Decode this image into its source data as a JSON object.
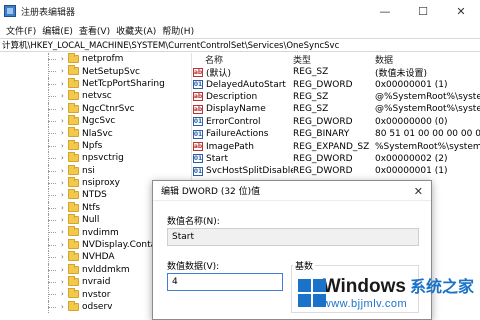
{
  "window": {
    "title": "注册表编辑器",
    "icon": "regedit-icon",
    "controls": {
      "minimize": "—",
      "maximize": "☐",
      "close": "✕"
    }
  },
  "menu": [
    "文件(F)",
    "编辑(E)",
    "查看(V)",
    "收藏夹(A)",
    "帮助(H)"
  ],
  "address": "计算机\\HKEY_LOCAL_MACHINE\\SYSTEM\\CurrentControlSet\\Services\\OneSyncSvc",
  "tree": [
    {
      "label": "netprofm",
      "expandable": true
    },
    {
      "label": "NetSetupSvc",
      "expandable": true
    },
    {
      "label": "NetTcpPortSharing",
      "expandable": true
    },
    {
      "label": "netvsc",
      "expandable": true
    },
    {
      "label": "NgcCtnrSvc",
      "expandable": true
    },
    {
      "label": "NgcSvc",
      "expandable": true
    },
    {
      "label": "NlaSvc",
      "expandable": true
    },
    {
      "label": "Npfs",
      "expandable": true
    },
    {
      "label": "npsvctrig",
      "expandable": true
    },
    {
      "label": "nsi",
      "expandable": true
    },
    {
      "label": "nsiproxy",
      "expandable": true
    },
    {
      "label": "NTDS",
      "expandable": true
    },
    {
      "label": "Ntfs",
      "expandable": true
    },
    {
      "label": "Null",
      "expandable": true
    },
    {
      "label": "nvdimm",
      "expandable": true
    },
    {
      "label": "NVDisplay.Container",
      "expandable": true
    },
    {
      "label": "NVHDA",
      "expandable": true
    },
    {
      "label": "nvlddmkm",
      "expandable": true
    },
    {
      "label": "nvraid",
      "expandable": true
    },
    {
      "label": "nvstor",
      "expandable": true
    },
    {
      "label": "odserv",
      "expandable": true
    }
  ],
  "values_header": {
    "name": "名称",
    "type": "类型",
    "data": "数据"
  },
  "values": [
    {
      "icon": "ab",
      "name": "(默认)",
      "type": "REG_SZ",
      "data": "(数值未设置)"
    },
    {
      "icon": "01",
      "name": "DelayedAutoStart",
      "type": "REG_DWORD",
      "data": "0x00000001 (1)"
    },
    {
      "icon": "ab",
      "name": "Description",
      "type": "REG_SZ",
      "data": "@%SystemRoot%\\system32"
    },
    {
      "icon": "ab",
      "name": "DisplayName",
      "type": "REG_SZ",
      "data": "@%SystemRoot%\\system32"
    },
    {
      "icon": "01",
      "name": "ErrorControl",
      "type": "REG_DWORD",
      "data": "0x00000000 (0)"
    },
    {
      "icon": "01",
      "name": "FailureActions",
      "type": "REG_BINARY",
      "data": "80 51 01 00 00 00 00 00 00"
    },
    {
      "icon": "ab",
      "name": "ImagePath",
      "type": "REG_EXPAND_SZ",
      "data": "%SystemRoot%\\system32\\"
    },
    {
      "icon": "01",
      "name": "Start",
      "type": "REG_DWORD",
      "data": "0x00000002 (2)"
    },
    {
      "icon": "01",
      "name": "SvcHostSplitDisable",
      "type": "REG_DWORD",
      "data": "0x00000001 (1)"
    }
  ],
  "dialog": {
    "title": "编辑 DWORD (32 位)值",
    "close": "✕",
    "name_label": "数值名称(N):",
    "name_value": "Start",
    "data_label": "数值数据(V):",
    "data_value": "4",
    "base_label": "基数"
  },
  "watermark": {
    "brand": "Windows",
    "brand_cn": "系统之家",
    "url": "www.bjjmlv.com"
  },
  "colors": {
    "selection": "#cce4f7",
    "folder": "#f2c94c",
    "watermark_blue": "#1a73c9"
  }
}
